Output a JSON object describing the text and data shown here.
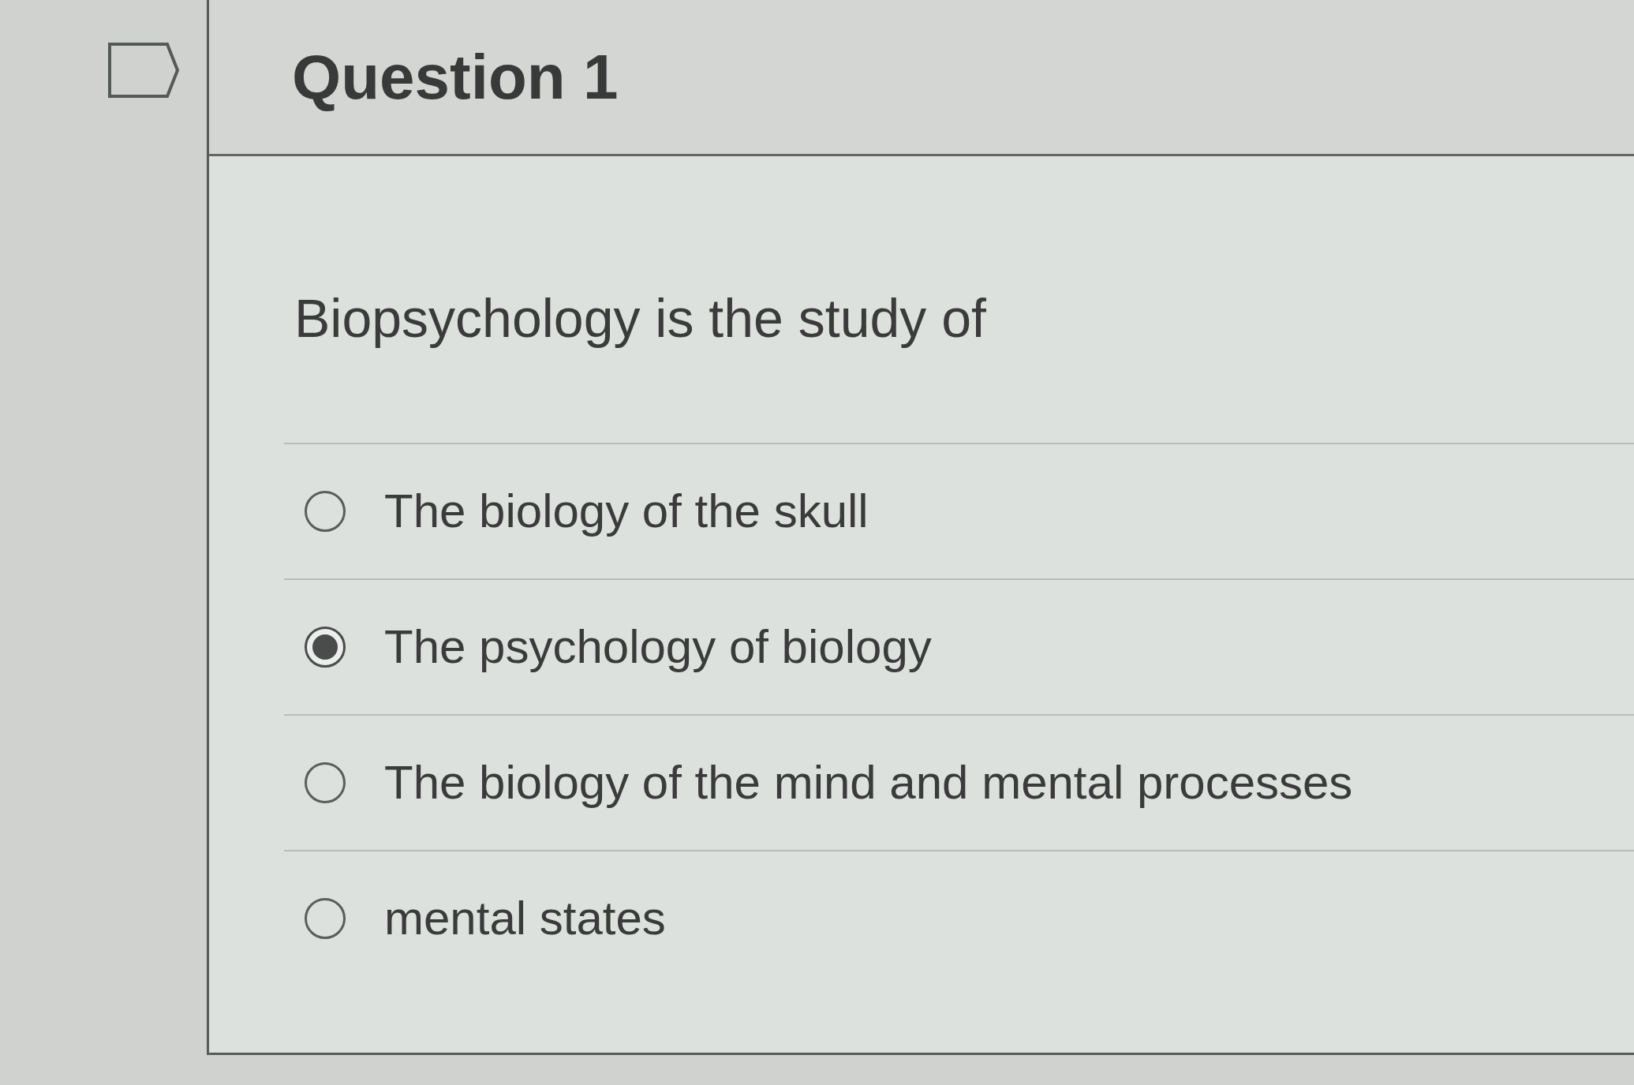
{
  "question": {
    "title": "Question 1",
    "prompt": "Biopsychology is the study of",
    "options": [
      {
        "label": "The biology of the skull",
        "selected": false
      },
      {
        "label": "The psychology of biology",
        "selected": true
      },
      {
        "label": "The biology of the mind and mental processes",
        "selected": false
      },
      {
        "label": "mental states",
        "selected": false
      }
    ]
  }
}
